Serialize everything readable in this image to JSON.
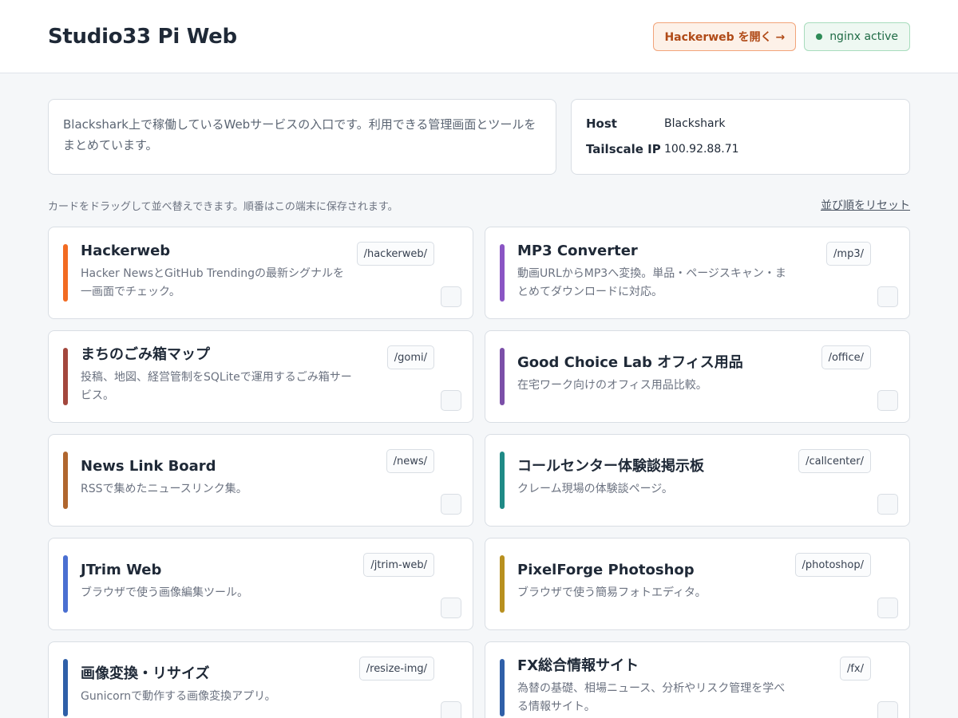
{
  "header": {
    "title": "Studio33 Pi Web",
    "open_button_label": "Hackerweb を開く →",
    "status_label": "nginx active"
  },
  "intro": {
    "text": "Blackshark上で稼働しているWebサービスの入口です。利用できる管理画面とツールをまとめています。"
  },
  "host_info": {
    "host_key": "Host",
    "host_value": "Blackshark",
    "ip_key": "Tailscale IP",
    "ip_value": "100.92.88.71"
  },
  "hint": {
    "text": "カードをドラッグして並べ替えできます。順番はこの端末に保存されます。",
    "reset_label": "並び順をリセット"
  },
  "cards": [
    {
      "title": "Hackerweb",
      "desc": "Hacker NewsとGitHub Trendingの最新シグナルを一画面でチェック。",
      "path": "/hackerweb/",
      "color": "#f26b22"
    },
    {
      "title": "MP3 Converter",
      "desc": "動画URLからMP3へ変換。単品・ページスキャン・まとめてダウンロードに対応。",
      "path": "/mp3/",
      "color": "#8a55c4"
    },
    {
      "title": "まちのごみ箱マップ",
      "desc": "投稿、地図、経営管制をSQLiteで運用するごみ箱サービス。",
      "path": "/gomi/",
      "color": "#a3473d"
    },
    {
      "title": "Good Choice Lab オフィス用品",
      "desc": "在宅ワーク向けのオフィス用品比較。",
      "path": "/office/",
      "color": "#7b4fa8"
    },
    {
      "title": "News Link Board",
      "desc": "RSSで集めたニュースリンク集。",
      "path": "/news/",
      "color": "#b0662e"
    },
    {
      "title": "コールセンター体験談掲示板",
      "desc": "クレーム現場の体験談ページ。",
      "path": "/callcenter/",
      "color": "#1f8a86"
    },
    {
      "title": "JTrim Web",
      "desc": "ブラウザで使う画像編集ツール。",
      "path": "/jtrim-web/",
      "color": "#4a6fd1"
    },
    {
      "title": "PixelForge Photoshop",
      "desc": "ブラウザで使う簡易フォトエディタ。",
      "path": "/photoshop/",
      "color": "#b8901f"
    },
    {
      "title": "画像変換・リサイズ",
      "desc": "Gunicornで動作する画像変換アプリ。",
      "path": "/resize-img/",
      "color": "#2f5fa8"
    },
    {
      "title": "FX総合情報サイト",
      "desc": "為替の基礎、相場ニュース、分析やリスク管理を学べる情報サイト。",
      "path": "/fx/",
      "color": "#2f5fa8"
    }
  ]
}
